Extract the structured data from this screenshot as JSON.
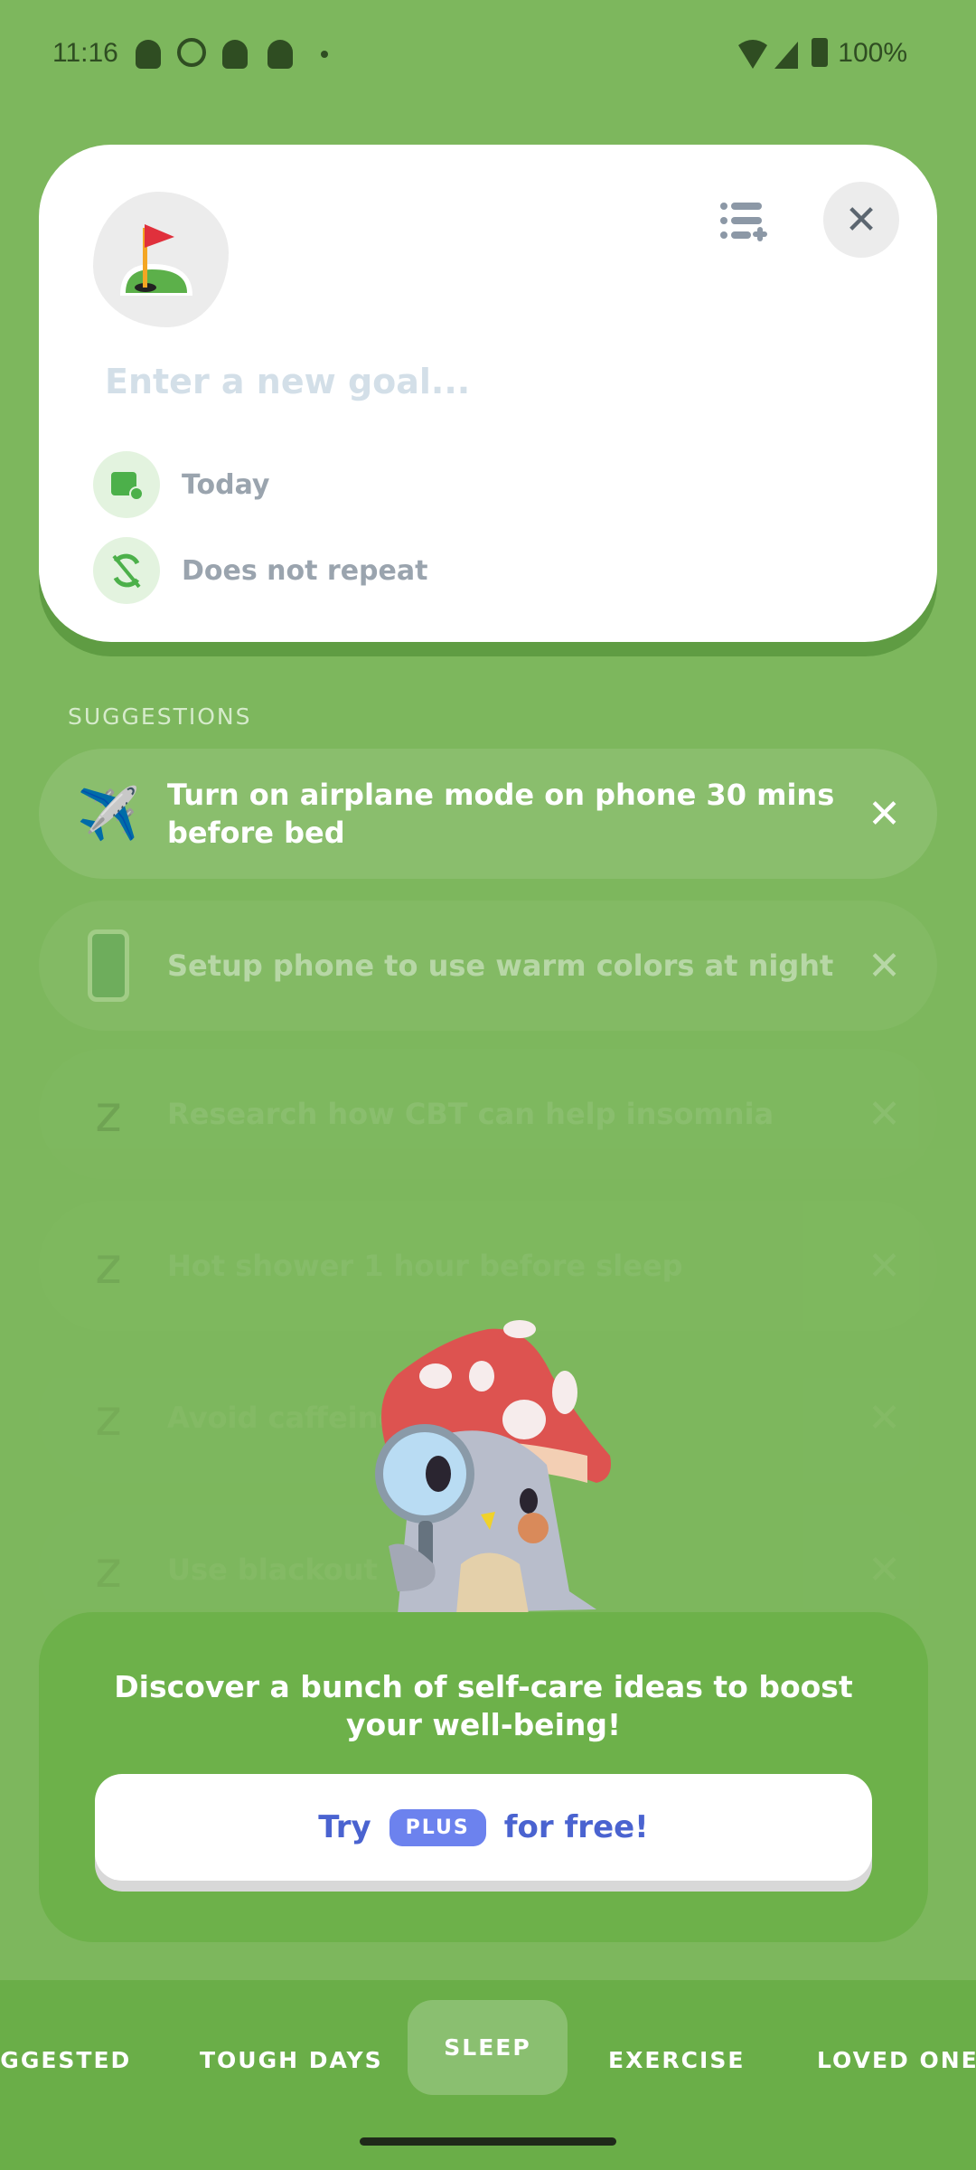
{
  "status_bar": {
    "time": "11:16",
    "battery": "100%",
    "notification_icons": [
      "snapchat-icon",
      "whatsapp-icon",
      "snapchat-icon",
      "snapchat-icon",
      "dot-icon"
    ]
  },
  "goal_card": {
    "icon": "golf-flag-icon",
    "placeholder": "Enter a new goal...",
    "date_label": "Today",
    "repeat_label": "Does not repeat"
  },
  "suggestions": {
    "heading": "SUGGESTIONS",
    "items": [
      {
        "icon": "airplane-icon",
        "label": "Turn on airplane mode on phone 30 mins before bed"
      },
      {
        "icon": "phone-icon",
        "label": "Setup phone to use warm colors at night"
      },
      {
        "icon": "sleep-icon",
        "label": "Research how CBT can help insomnia"
      },
      {
        "icon": "shower-icon",
        "label": "Hot shower 1 hour before sleep"
      },
      {
        "icon": "sleep-icon",
        "label": "Avoid caffeine"
      },
      {
        "icon": "sleep-icon",
        "label": "Use blackout"
      }
    ]
  },
  "promo": {
    "message": "Discover a bunch of self-care ideas to boost your well-being!",
    "button_prefix": "Try",
    "badge": "PLUS",
    "button_suffix": "for free!"
  },
  "tabs": [
    {
      "label": "SUGGESTED"
    },
    {
      "label": "TOUGH DAYS"
    },
    {
      "label": "SLEEP",
      "selected": true
    },
    {
      "label": "EXERCISE"
    },
    {
      "label": "LOVED ONES"
    }
  ],
  "colors": {
    "background": "#7db75d",
    "accent": "#4a63d0",
    "plus_badge": "#6c82ee"
  }
}
